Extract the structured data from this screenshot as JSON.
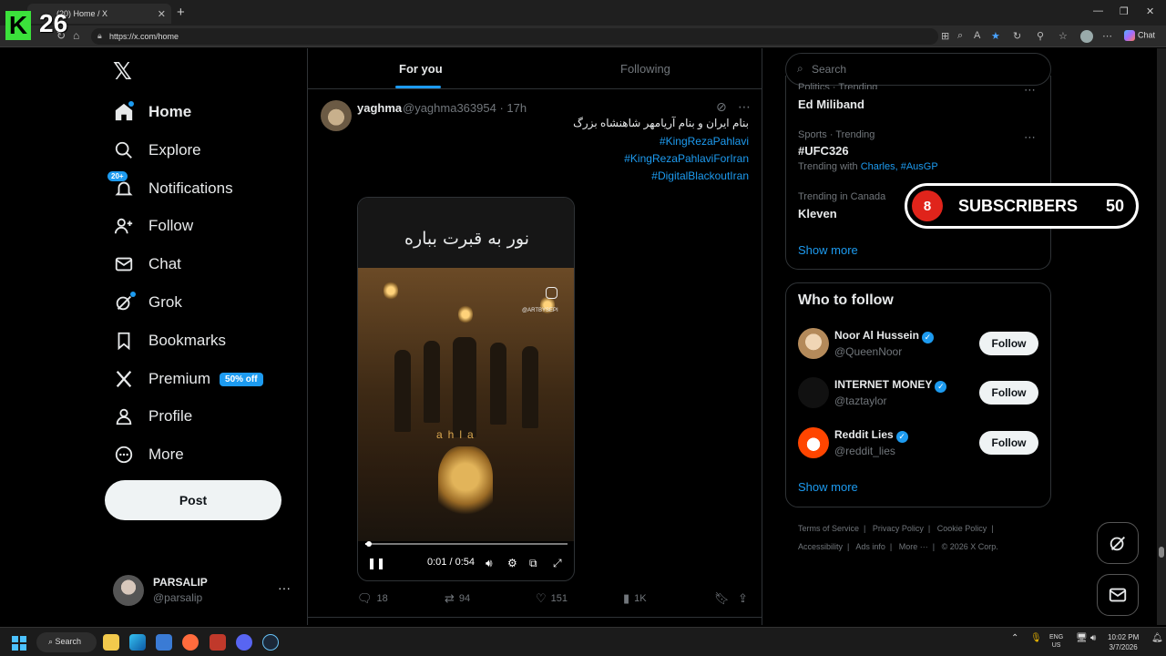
{
  "browser": {
    "tab_title": "(20) Home / X",
    "tab_close": "✕",
    "new_tab": "+",
    "url": "https://x.com/home",
    "chat_label": "Chat",
    "window_controls": [
      "—",
      "❐",
      "✕"
    ]
  },
  "overlay_logo": {
    "k": "K",
    "num": "26"
  },
  "nav": {
    "logo": "𝕏",
    "items": [
      {
        "label": "Home",
        "icon": "home-icon",
        "glyph": "⌂"
      },
      {
        "label": "Explore",
        "icon": "search-icon",
        "glyph": "⌕"
      },
      {
        "label": "Notifications",
        "icon": "bell-icon",
        "glyph": "🔔︎",
        "badge": "20+"
      },
      {
        "label": "Follow",
        "icon": "add-person-icon",
        "glyph": "👤︎"
      },
      {
        "label": "Chat",
        "icon": "mail-icon",
        "glyph": "✉"
      },
      {
        "label": "Grok",
        "icon": "grok-icon",
        "glyph": "⊘"
      },
      {
        "label": "Bookmarks",
        "icon": "bookmark-icon",
        "glyph": "🔖︎"
      },
      {
        "label": "Premium",
        "icon": "x-premium-icon",
        "glyph": "𝕏",
        "promo": "50% off"
      },
      {
        "label": "Profile",
        "icon": "profile-icon",
        "glyph": "👤︎"
      },
      {
        "label": "More",
        "icon": "more-circle-icon",
        "glyph": "⋯"
      }
    ],
    "post_button": "Post",
    "account": {
      "name": "PARSALIP",
      "handle": "@parsalip",
      "more": "···"
    }
  },
  "feed": {
    "tabs": [
      "For you",
      "Following"
    ],
    "post": {
      "name": "yaghma",
      "meta": "@yaghma363954 · 17h",
      "lines": [
        "بنام ایران و بنام آریامهر شاهنشاه بزرگ",
        "#KingRezaPahlavi",
        "#KingRezaPahlaviForIran",
        "#DigitalBlackoutIran"
      ],
      "video": {
        "caption": "نور به قبرت بباره",
        "ig_tag": "@ARTBYSEPI",
        "overlay_text": "ahla",
        "time": "0:01 / 0:54",
        "progress": 0.02
      },
      "stats": {
        "replies": "18",
        "reposts": "94",
        "likes": "151",
        "views": "1K"
      }
    }
  },
  "sidebar": {
    "search_placeholder": "Search",
    "trends": [
      {
        "meta": "Politics · Trending",
        "title": "Ed Miliband"
      },
      {
        "meta": "Sports · Trending",
        "title": "#UFC326",
        "with_label": "Trending with",
        "with_links": "Charles, #AusGP"
      },
      {
        "meta": "Trending in Canada",
        "title": "Kleven"
      }
    ],
    "show_more": "Show more",
    "who_to_follow": {
      "title": "Who to follow",
      "accounts": [
        {
          "name": "Noor Al Hussein",
          "handle": "@QueenNoor"
        },
        {
          "name": "INTERNET MONEY",
          "handle": "@taztaylor"
        },
        {
          "name": "Reddit Lies",
          "handle": "@reddit_lies"
        }
      ],
      "follow_label": "Follow",
      "show_more": "Show more"
    },
    "footer": [
      "Terms of Service",
      "Privacy Policy",
      "Cookie Policy",
      "Accessibility",
      "Ads info",
      "More ···",
      "© 2026 X Corp."
    ]
  },
  "subscribers": {
    "badge": "8",
    "label": "SUBSCRIBERS",
    "count": "50"
  },
  "taskbar": {
    "search": "Search",
    "lang": "ENG",
    "region": "US",
    "time": "10:02 PM",
    "date": "3/7/2026"
  }
}
